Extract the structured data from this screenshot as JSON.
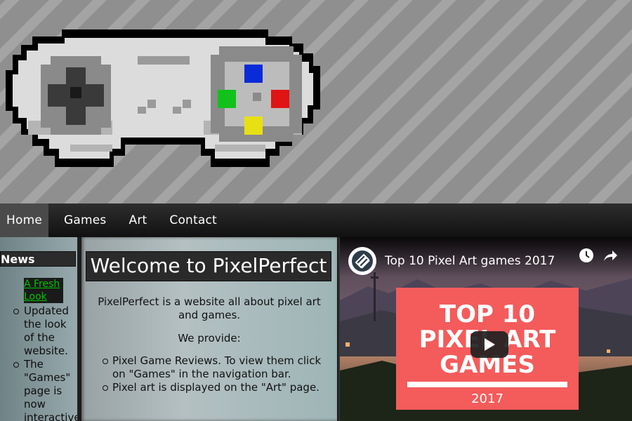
{
  "nav": {
    "items": [
      {
        "label": "Home",
        "active": true
      },
      {
        "label": "Games",
        "active": false
      },
      {
        "label": "Art",
        "active": false
      },
      {
        "label": "Contact",
        "active": false
      }
    ]
  },
  "news": {
    "title": "News",
    "headline": "A Fresh Look",
    "items": [
      "Updated the look of the website.",
      "The \"Games\" page is now interactive"
    ]
  },
  "main": {
    "heading": "Welcome to PixelPerfect",
    "intro": "PixelPerfect is a website all about pixel art and games.",
    "provide_label": "We provide:",
    "provide_items": [
      "Pixel Game Reviews. To view them click on \"Games\" in the navigation bar.",
      "Pixel art is displayed on the \"Art\" page."
    ]
  },
  "video": {
    "title": "Top 10 Pixel Art games 2017",
    "thumbnail": {
      "line1": "TOP 10",
      "line2": "PIXEL ART",
      "line3": "GAMES",
      "year": "2017"
    }
  },
  "colors": {
    "nav_active": "#4a4a4a",
    "headline_text": "#00c400",
    "thumbnail_bg": "#f45b5b"
  },
  "icons": {
    "banner": "pixel-gamepad-logo",
    "video_channel": "channel-logo-icon",
    "video_watch_later": "clock-icon",
    "video_share": "share-icon",
    "video_play": "play-icon"
  }
}
